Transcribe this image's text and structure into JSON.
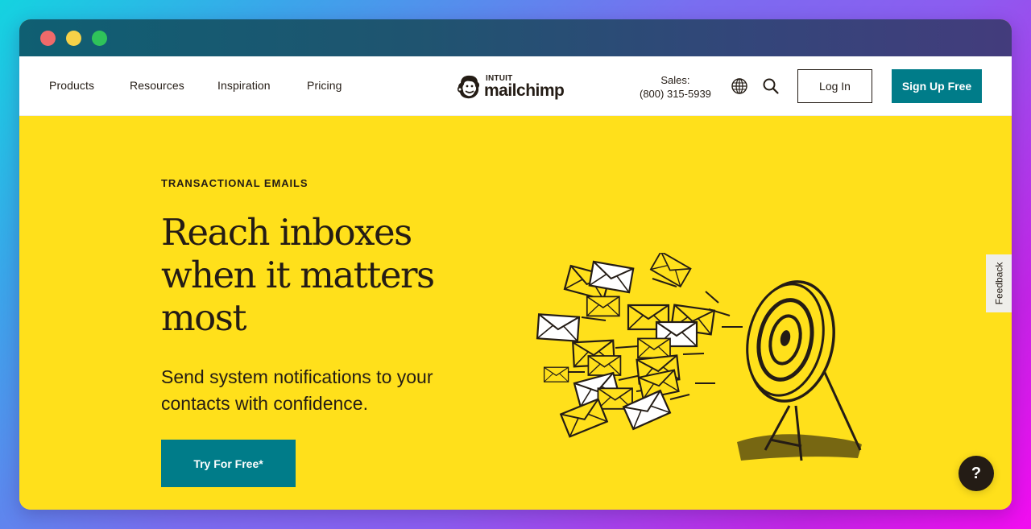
{
  "window": {
    "controls": [
      {
        "name": "close",
        "color": "#ef6a6a"
      },
      {
        "name": "minimize",
        "color": "#f6d148"
      },
      {
        "name": "maximize",
        "color": "#2fc35a"
      }
    ]
  },
  "nav": {
    "links": [
      "Products",
      "Resources",
      "Inspiration",
      "Pricing"
    ],
    "logo": {
      "brand_top": "INTUIT",
      "brand_word": "mailchimp",
      "icon": "freddie-chimp-icon"
    },
    "sales_label": "Sales:",
    "sales_phone": "(800) 315-5939",
    "globe_icon": "globe-icon",
    "search_icon": "search-icon",
    "login_label": "Log In",
    "signup_label": "Sign Up Free"
  },
  "hero": {
    "eyebrow": "TRANSACTIONAL EMAILS",
    "headline": "Reach inboxes when it matters most",
    "subhead": "Send system notifications to your contacts with confidence.",
    "cta_label": "Try For Free*",
    "illustration": "envelopes-flying-to-target-illustration"
  },
  "widgets": {
    "feedback_label": "Feedback",
    "help_label": "?"
  },
  "colors": {
    "brand_yellow": "#ffe01b",
    "brand_teal": "#007c89",
    "text_dark": "#241c15"
  }
}
